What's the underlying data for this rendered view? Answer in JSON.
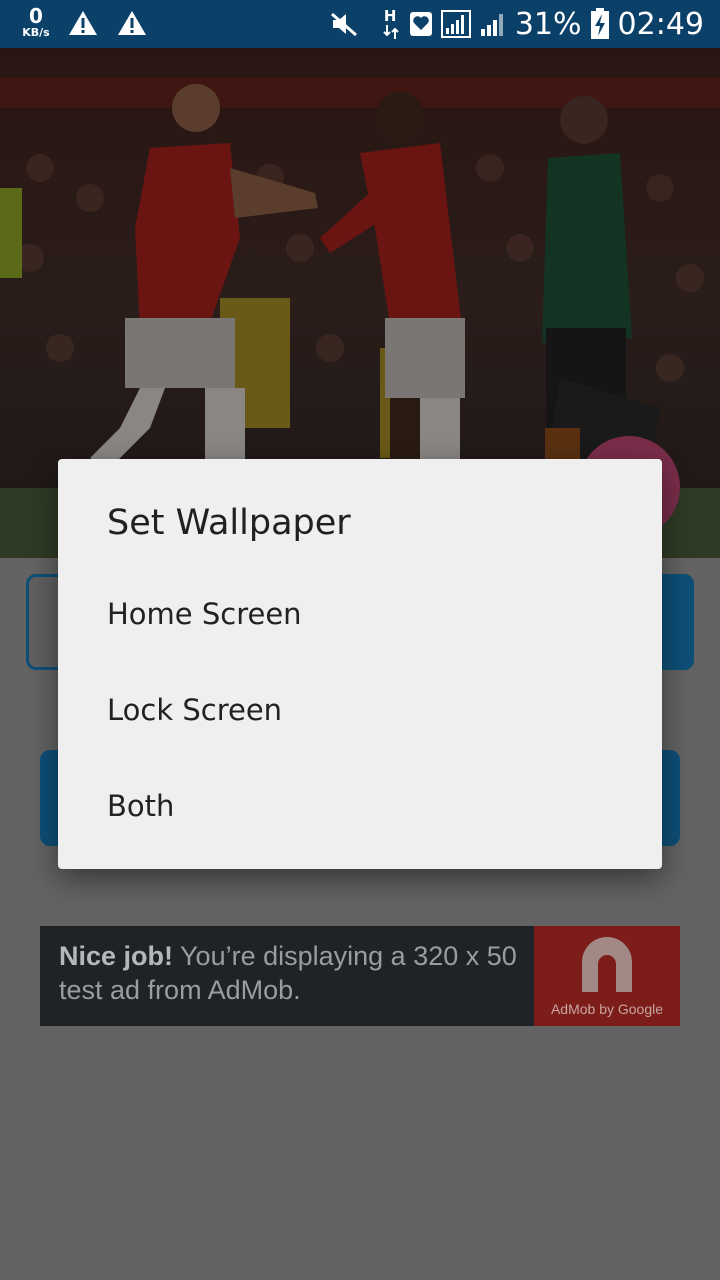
{
  "status_bar": {
    "net_speed_value": "0",
    "net_speed_unit": "KB/s",
    "network_type": "H",
    "battery_percent": "31%",
    "time": "02:49",
    "icons": [
      "warning-icon",
      "warning-icon",
      "mute-icon",
      "data-transfer-icon",
      "heart-notification-icon",
      "signal-icon",
      "signal-icon",
      "battery-charging-icon"
    ]
  },
  "dialog": {
    "title": "Set Wallpaper",
    "options": [
      "Home Screen",
      "Lock Screen",
      "Both"
    ]
  },
  "ad": {
    "bold_text": "Nice job!",
    "text": " You’re displaying a 320 x 50 test ad from AdMob.",
    "logo_text": "AdMob by Google"
  },
  "colors": {
    "status_bar": "#0b4068",
    "button_accent": "#0e4f78",
    "fab": "#7a2d4a",
    "dialog_bg": "#efefef",
    "scrim_bg": "#636363"
  }
}
